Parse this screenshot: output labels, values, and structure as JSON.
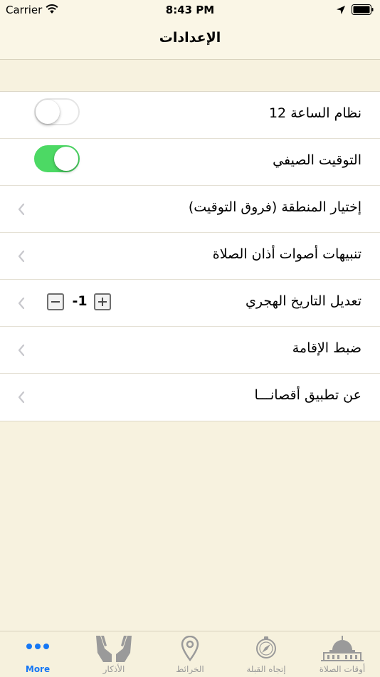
{
  "status_bar": {
    "carrier": "Carrier",
    "time": "8:43 PM"
  },
  "nav": {
    "title": "الإعدادات"
  },
  "settings": [
    {
      "label": "نظام الساعة 12",
      "control": "toggle",
      "on": false
    },
    {
      "label": "التوقيت الصيفي",
      "control": "toggle",
      "on": true
    },
    {
      "label": "إختيار المنطقة (فروق التوقيت)",
      "control": "chevron"
    },
    {
      "label": "تنبيهات أصوات أذان الصلاة",
      "control": "chevron"
    },
    {
      "label": "تعديل التاريخ الهجري",
      "control": "stepper",
      "value": "-1"
    },
    {
      "label": "ضبط الإقامة",
      "control": "chevron"
    },
    {
      "label": "عن تطبيق أقصانـــا",
      "control": "chevron"
    }
  ],
  "tabs": {
    "more": "More",
    "azkar": "الأذكار",
    "maps": "الخرائط",
    "qibla": "إتجاه القبلة",
    "prayer_times": "أوقات الصلاة"
  },
  "colors": {
    "background": "#F7F2DF",
    "toggle_on": "#4CD964",
    "tab_active": "#1577F5",
    "tab_inactive": "#9A9A9A"
  }
}
